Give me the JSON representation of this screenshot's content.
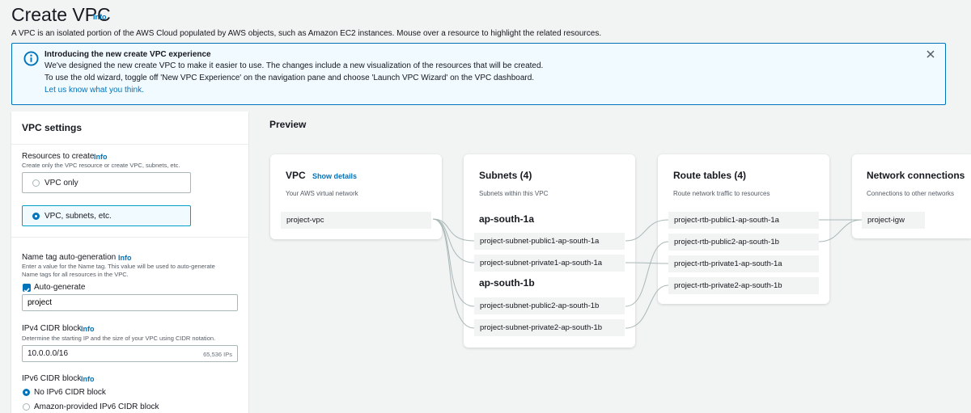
{
  "header": {
    "title": "Create VPC",
    "info": "Info",
    "description": "A VPC is an isolated portion of the AWS Cloud populated by AWS objects, such as Amazon EC2 instances. Mouse over a resource to highlight the related resources."
  },
  "banner": {
    "title": "Introducing the new create VPC experience",
    "line1": "We've designed the new create VPC to make it easier to use. The changes include a new visualization of the resources that will be created.",
    "line2": "To use the old wizard, toggle off 'New VPC Experience' on the navigation pane and choose 'Launch VPC Wizard' on the VPC dashboard.",
    "link": "Let us know what you think."
  },
  "settings": {
    "title": "VPC settings",
    "resources": {
      "label": "Resources to create",
      "info": "Info",
      "hint": "Create only the VPC resource or create VPC, subnets, etc.",
      "options": [
        {
          "label": "VPC only",
          "selected": false
        },
        {
          "label": "VPC, subnets, etc.",
          "selected": true
        }
      ]
    },
    "name_tag": {
      "label": "Name tag auto-generation",
      "info": "Info",
      "hint_line1": "Enter a value for the Name tag. This value will be used to auto-generate",
      "hint_line2": "Name tags for all resources in the VPC.",
      "auto_generate_label": "Auto-generate",
      "auto_generate_checked": true,
      "value": "project"
    },
    "ipv4": {
      "label": "IPv4 CIDR block",
      "info": "Info",
      "hint": "Determine the starting IP and the size of your VPC using CIDR notation.",
      "value": "10.0.0.0/16",
      "ip_count": "65,536 IPs"
    },
    "ipv6": {
      "label": "IPv6 CIDR block",
      "info": "Info",
      "options": [
        {
          "label": "No IPv6 CIDR block",
          "selected": true
        },
        {
          "label": "Amazon-provided IPv6 CIDR block",
          "selected": false
        }
      ]
    }
  },
  "preview": {
    "title": "Preview",
    "vpc": {
      "title": "VPC",
      "show_details": "Show details",
      "subtitle": "Your AWS virtual network",
      "items": [
        "project-vpc"
      ]
    },
    "subnets": {
      "title": "Subnets (4)",
      "subtitle": "Subnets within this VPC",
      "zones": [
        {
          "name": "ap-south-1a",
          "items": [
            "project-subnet-public1-ap-south-1a",
            "project-subnet-private1-ap-south-1a"
          ]
        },
        {
          "name": "ap-south-1b",
          "items": [
            "project-subnet-public2-ap-south-1b",
            "project-subnet-private2-ap-south-1b"
          ]
        }
      ]
    },
    "route_tables": {
      "title": "Route tables (4)",
      "subtitle": "Route network traffic to resources",
      "items": [
        "project-rtb-public1-ap-south-1a",
        "project-rtb-public2-ap-south-1b",
        "project-rtb-private1-ap-south-1a",
        "project-rtb-private2-ap-south-1b"
      ]
    },
    "network": {
      "title": "Network connections",
      "subtitle": "Connections to other networks",
      "items": [
        "project-igw"
      ]
    }
  },
  "colors": {
    "accent": "#0073bb",
    "selected_border": "#00a1c9",
    "banner_bg": "#f1faff",
    "page_bg": "#f2f3f3"
  }
}
